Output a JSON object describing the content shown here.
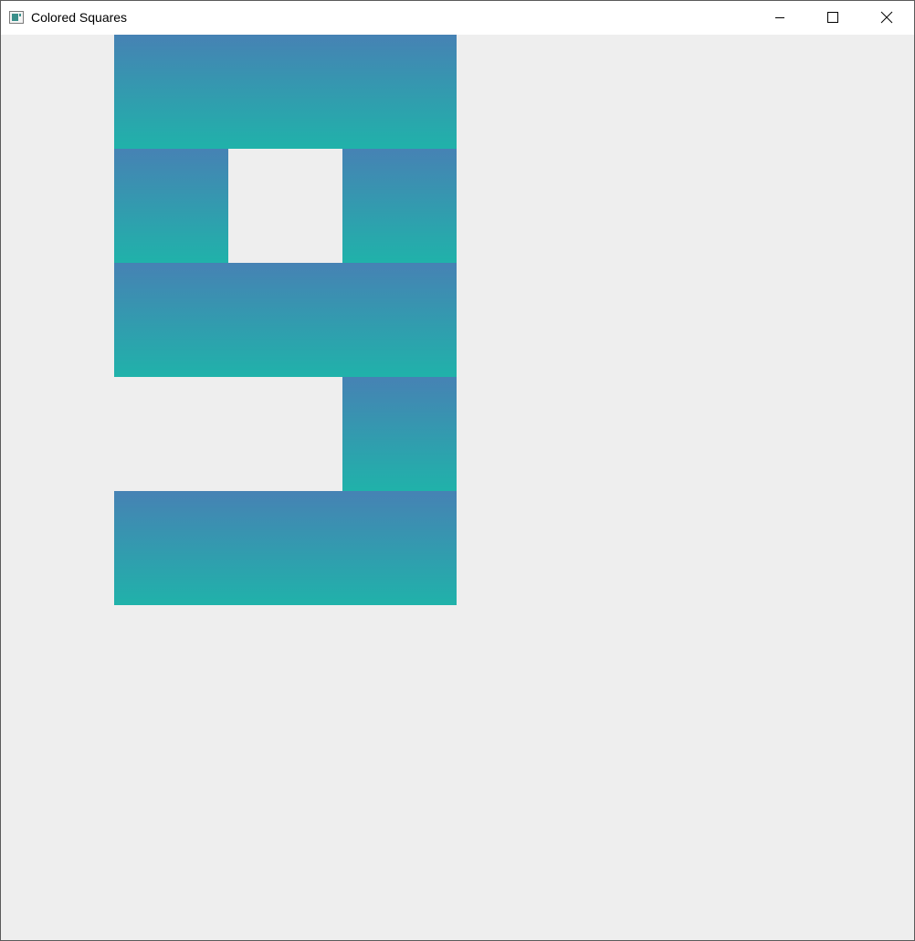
{
  "window": {
    "title": "Colored Squares",
    "controls": {
      "minimize": "minimize-icon",
      "maximize": "maximize-icon",
      "close": "close-icon"
    }
  },
  "grid": {
    "columns": 3,
    "rows": 5,
    "gradient_top": "#4682B4",
    "gradient_bottom": "#20B2AA",
    "background": "#EEEEEE",
    "pattern": [
      [
        1,
        1,
        1
      ],
      [
        1,
        0,
        1
      ],
      [
        1,
        1,
        1
      ],
      [
        0,
        0,
        1
      ],
      [
        1,
        1,
        1
      ]
    ]
  }
}
